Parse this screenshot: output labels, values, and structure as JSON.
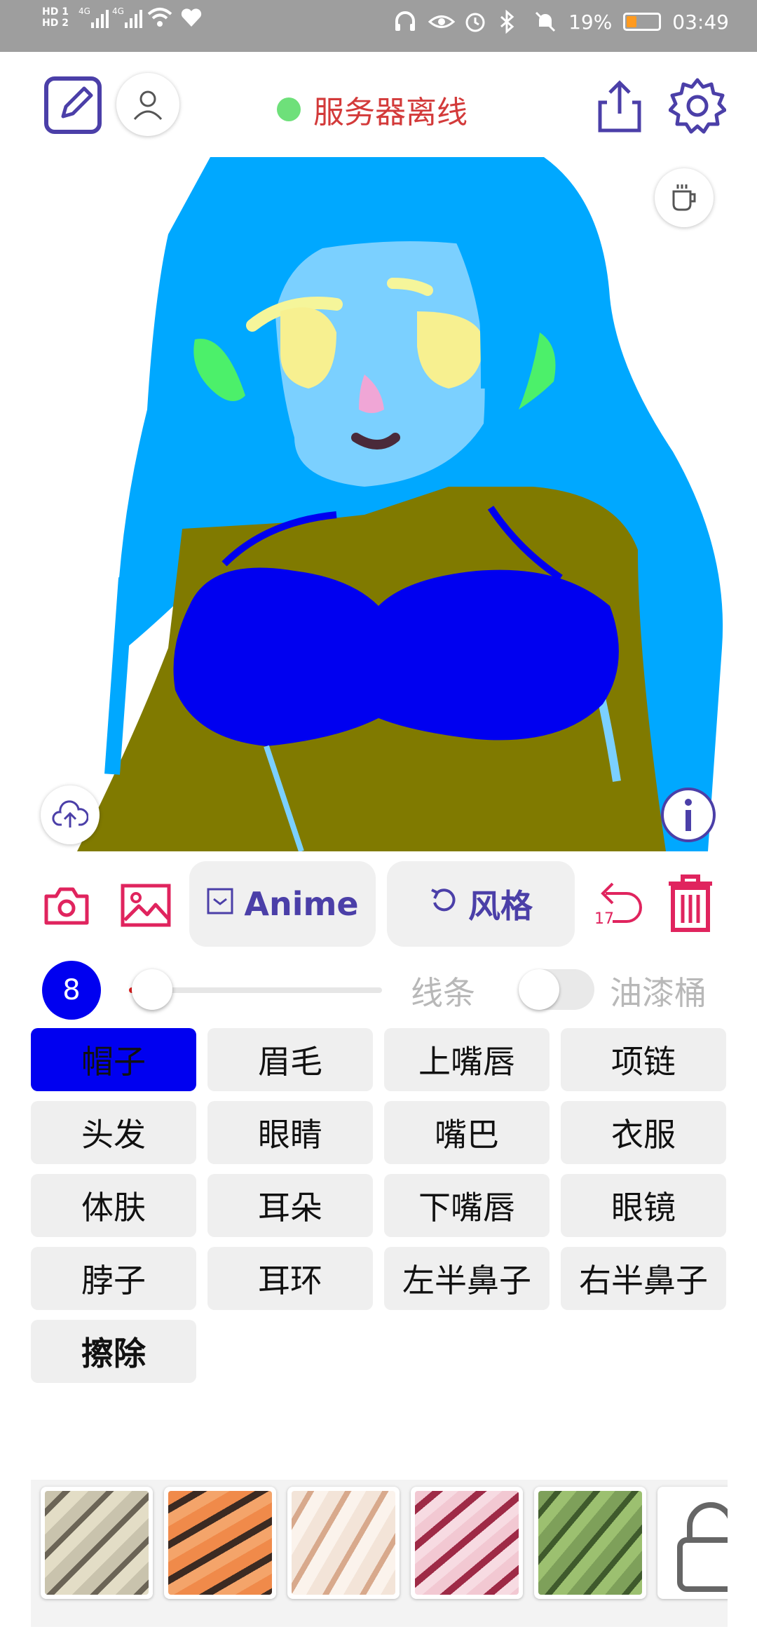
{
  "statusbar": {
    "sim1": "HD 1",
    "sim2": "HD 2",
    "net1": "4G",
    "net2": "4G",
    "battery": "19%",
    "time": "03:49"
  },
  "header": {
    "server_status": "服务器离线",
    "status_color": "#6ee07a"
  },
  "toolbar": {
    "model_label": "Anime",
    "style_label": "风格",
    "undo_count": "17"
  },
  "brush": {
    "size": "8",
    "line_label": "线条",
    "bucket_label": "油漆桶",
    "active_color": "#0000f0"
  },
  "parts": [
    "帽子",
    "眉毛",
    "上嘴唇",
    "项链",
    "头发",
    "眼睛",
    "嘴巴",
    "衣服",
    "体肤",
    "耳朵",
    "下嘴唇",
    "眼镜",
    "脖子",
    "耳环",
    "左半鼻子",
    "右半鼻子",
    "擦除"
  ],
  "colors": {
    "accent": "#4b3fa8",
    "danger": "#e0245e",
    "hair": "#00a8ff",
    "skin": "#7bd0ff",
    "clothes": "#807a00",
    "top": "#0000f0"
  }
}
